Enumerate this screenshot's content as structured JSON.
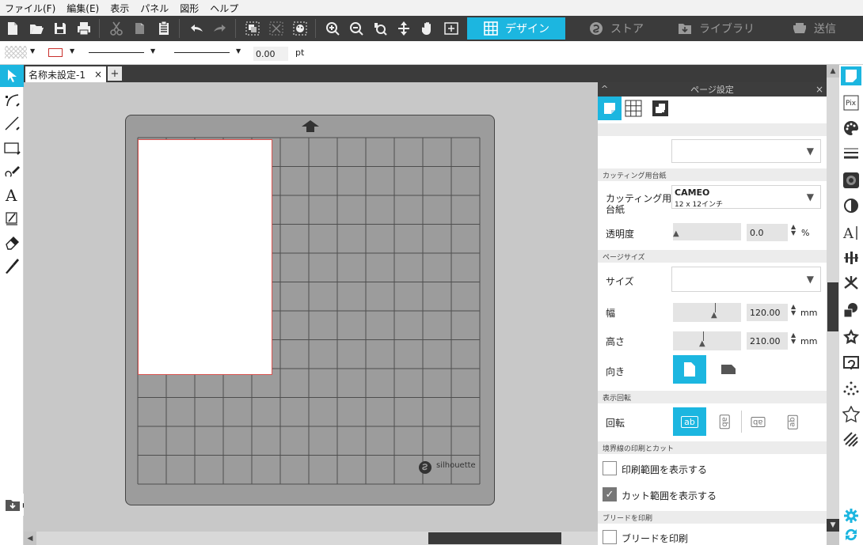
{
  "menu": [
    "ファイル(F)",
    "編集(E)",
    "表示",
    "パネル",
    "図形",
    "ヘルプ"
  ],
  "nav_tabs": {
    "design": "デザイン",
    "store": "ストア",
    "library": "ライブラリ",
    "send": "送信"
  },
  "line_bar": {
    "width_value": "0.00",
    "unit": "pt"
  },
  "document": {
    "tab_title": "名称未設定-1",
    "close_glyph": "×",
    "add_glyph": "+"
  },
  "mat": {
    "brand": "silhouette"
  },
  "panel": {
    "title": "ページ設定",
    "close_glyph": "×",
    "sections": {
      "cutting_mat": "カッティング用台紙",
      "page_size": "ページサイズ",
      "show_rotate": "表示回転",
      "border": "境界線の印刷とカット",
      "bleed": "ブリードを印刷"
    },
    "cutting_mat_label": "カッティング用台紙",
    "cutting_mat_value": "CAMEO",
    "cutting_mat_sub": "12 x 12インチ",
    "transparency_label": "透明度",
    "transparency_value": "0.0",
    "transparency_unit": "%",
    "size_label": "サイズ",
    "width_label": "幅",
    "width_value": "120.00",
    "height_label": "高さ",
    "height_value": "210.00",
    "length_unit": "mm",
    "orientation_label": "向き",
    "rotate_label": "回転",
    "rotate_glyph": "ab",
    "show_print_label": "印刷範囲を表示する",
    "show_cut_label": "カット範囲を表示する",
    "print_bleed_label": "ブリードを印刷",
    "check_glyph": "✓"
  },
  "colors": {
    "accent": "#1cb6e0",
    "toolbar": "#3b3b3b",
    "mat": "#9c9c9c",
    "paper_border": "#d9534f"
  }
}
